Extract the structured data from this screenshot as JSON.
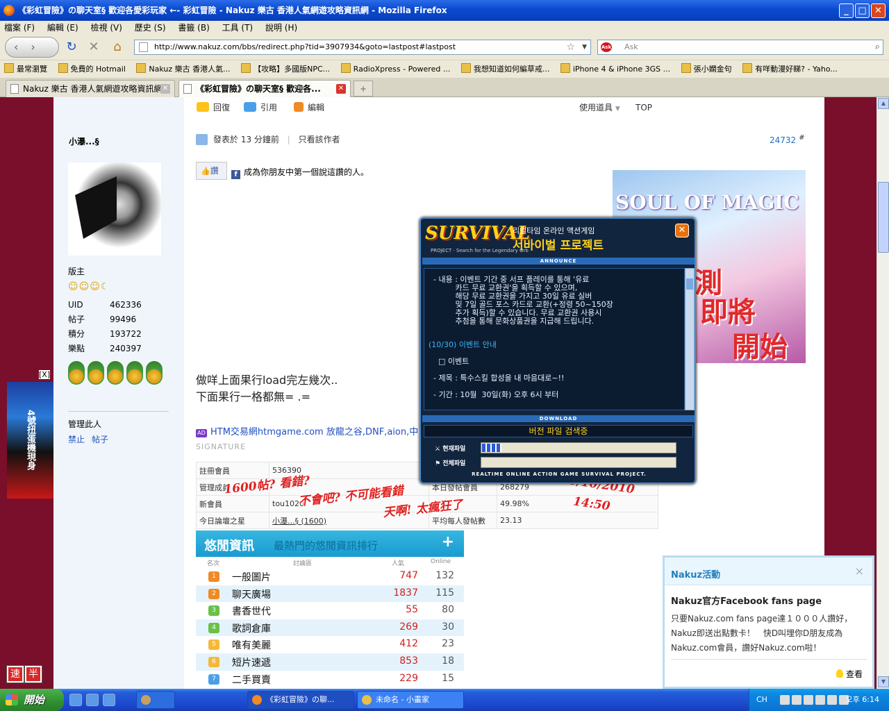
{
  "window": {
    "title": "《彩虹冒險》の聊天室§ 歡迎各愛彩玩家 ←- 彩虹冒險 - Nakuz 樂古 香港人氣網遊攻略資訊網 - Mozilla Firefox"
  },
  "menu": [
    "檔案 (F)",
    "編輯 (E)",
    "檢視 (V)",
    "歷史 (S)",
    "書籤 (B)",
    "工具 (T)",
    "說明 (H)"
  ],
  "nav": {
    "url": "http://www.nakuz.com/bbs/redirect.php?tid=3907934&goto=lastpost#lastpost",
    "search_placeholder": "Ask",
    "search_engine": "Ask"
  },
  "bookmarks": [
    "最常瀏覽",
    "免費的 Hotmail",
    "Nakuz 樂古 香港人氣...",
    "【攻略】多國版NPC...",
    "RadioXpress - Powered ...",
    "我想知道如何編草戒...",
    "iPhone 4 & iPhone 3GS ...",
    "張小嫻金句",
    "有咩動漫好睇? - Yaho..."
  ],
  "tabs": [
    {
      "label": "Nakuz 樂古 香港人氣網遊攻略資訊網",
      "active": false
    },
    {
      "label": "《彩虹冒險》の聊天室§ 歡迎各...",
      "active": true
    }
  ],
  "post_toolbar": {
    "reply": "回復",
    "quote": "引用",
    "edit": "編輯",
    "tools": "使用道具",
    "top": "TOP"
  },
  "user": {
    "name": "小瀑...§",
    "role": "版主",
    "stats": [
      {
        "label": "UID",
        "value": "462336"
      },
      {
        "label": "帖子",
        "value": "99496"
      },
      {
        "label": "積分",
        "value": "193722"
      },
      {
        "label": "樂點",
        "value": "240397"
      }
    ],
    "manage_label": "管理此人",
    "ban": "禁止",
    "posts": "帖子"
  },
  "post": {
    "meta": "發表於 13 分鐘前",
    "only_author": "只看該作者",
    "number": "24732",
    "hash": "#",
    "like": "讚",
    "fb_text": "成為你朋友中第一個說這讚的人。",
    "body_line1": "做咩上面果行load完左幾次..",
    "body_line2": "下面果行一格都無= .=",
    "htm_ad": "HTM交易網htmgame.com 放龍之谷,DNF,aion,中",
    "signature": "SIGNATURE"
  },
  "stats_table": [
    [
      "註冊會員",
      "536390",
      "",
      ""
    ],
    [
      "管理成員",
      "",
      "本日發帖會員",
      "268279"
    ],
    [
      "新會員",
      "tou1020",
      "",
      "49.98%"
    ],
    [
      "今日論壇之星",
      "小瀑...§ (1600)",
      "平均每人發帖數",
      "23.13"
    ]
  ],
  "overlay": {
    "l1": "1600帖? 看錯?",
    "l2": "不會吧? 不可能看錯",
    "l3": "天啊! 太瘋狂了",
    "date": "30/10/2010",
    "time": "14:50"
  },
  "ad_magic": {
    "title": "SOUL OF MAGIC",
    "t1": "測",
    "t2": "即將",
    "t3": "開始"
  },
  "ranking": {
    "title": "悠閒資訊",
    "subtitle": "最熱門的悠閒資訊排行",
    "plus": "+",
    "cols": {
      "rank": "名次",
      "board": "討論區",
      "pop": "人氣",
      "online": "Online"
    },
    "rows": [
      {
        "n": "1",
        "name": "一般圖片",
        "hot": "747",
        "online": "132"
      },
      {
        "n": "2",
        "name": "聊天廣場",
        "hot": "1837",
        "online": "115"
      },
      {
        "n": "3",
        "name": "書香世代",
        "hot": "55",
        "online": "80"
      },
      {
        "n": "4",
        "name": "歌詞倉庫",
        "hot": "269",
        "online": "30"
      },
      {
        "n": "5",
        "name": "唯有美麗",
        "hot": "412",
        "online": "23"
      },
      {
        "n": "6",
        "name": "短片速遞",
        "hot": "853",
        "online": "18"
      },
      {
        "n": "7",
        "name": "二手買賣",
        "hot": "229",
        "online": "15"
      }
    ]
  },
  "side_ad": {
    "text": "4號扭蛋機現身",
    "close": "[X]"
  },
  "speed": [
    "速",
    "半"
  ],
  "popup": {
    "logo": "SURVIVAL",
    "logo_sub": "PROJECT · Search for the Legendary Orb",
    "ko1": "리얼타임 온라인 액션게임",
    "ko2": "서바이벌 프로젝트",
    "close": "✕",
    "announce": "ANNOUNCE",
    "lines": [
      "  - 내용 : 이벤트 기간 중 서프 플레이를 통해 '유료",
      "           카드 무료 교환권'을 획득할 수 있으며,",
      "           해당 무료 교환권을 가지고 30일 유료 실버",
      "           및 7일 골드 포스 카드로 교환(+정령 50~150장",
      "           추가 획득)할 수 있습니다. 무료 교환권 사용시",
      "           추첨을 통해 문화상품권을 지급해 드립니다."
    ],
    "event_title": "(10/30) 이벤트 안내",
    "event_box": "□ 이벤트",
    "event_subject": "  - 제목 : 특수스킬 합성을 내 마음대로~!!",
    "event_period": "  - 기간 : 10월  30일(화) 오후 6시 부터",
    "download": "DOWNLOAD",
    "version": "버전 파일 검색중",
    "bar1_label": "현재파일",
    "bar1_progress": 0.1,
    "bar2_label": "전체파일",
    "bar2_progress": 0,
    "footer": "REALTIME ONLINE ACTION GAME SURVIVAL PROJECT."
  },
  "nakuz": {
    "header": "Nakuz活動",
    "close": "×",
    "title": "Nakuz官方Facebook fans page",
    "body": "只要Nakuz.com fans page達１０００人讚好，Nakuz即送出點數卡！　快D叫埋你D朋友成為Nakuz.com會員，讚好Nakuz.com啦！",
    "more": "查看"
  },
  "taskbar": {
    "start": "開始",
    "items": [
      "《彩虹冒險》の聊...",
      "未命名 - 小畫家"
    ],
    "lang": "CH",
    "time": "오후 6:14"
  }
}
